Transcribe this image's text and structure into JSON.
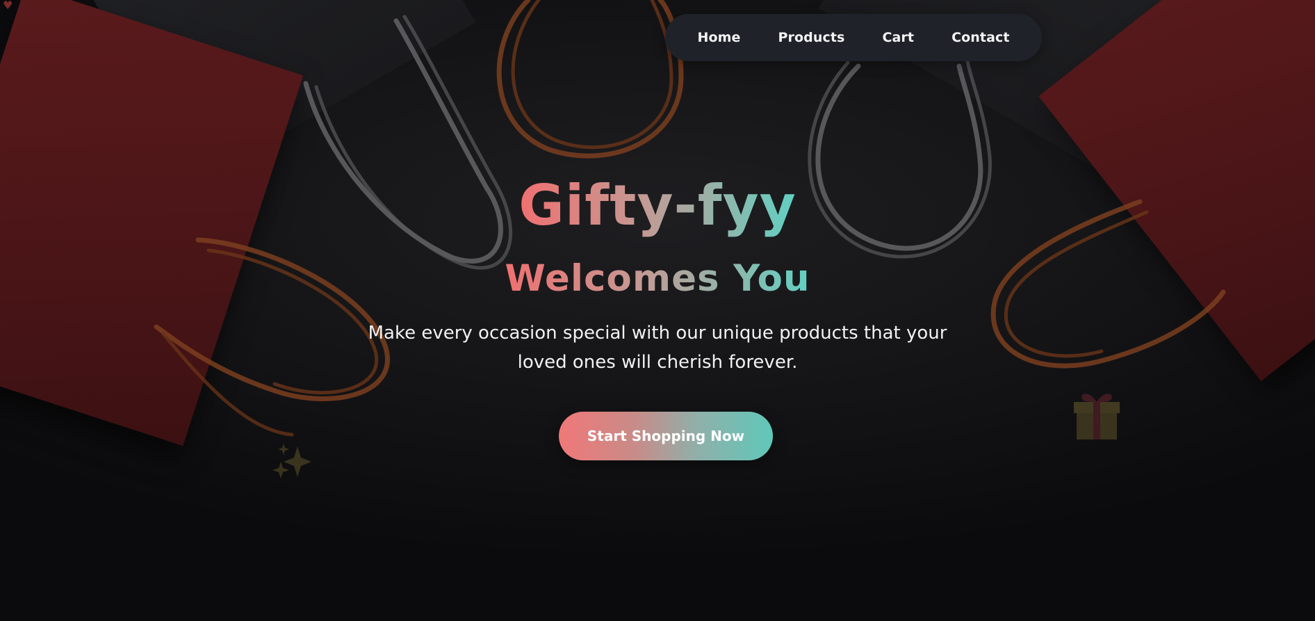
{
  "nav": {
    "items": [
      {
        "label": "Home"
      },
      {
        "label": "Products"
      },
      {
        "label": "Cart"
      },
      {
        "label": "Contact"
      }
    ]
  },
  "hero": {
    "title": "Gifty-fyy",
    "subtitle": "Welcomes You",
    "tagline": "Make every occasion special with our unique products that your loved ones will cherish forever.",
    "cta_label": "Start Shopping Now"
  },
  "colors": {
    "gradient_start": "#f07070",
    "gradient_end": "#5fd1c2",
    "nav_background": "#1f2329",
    "page_background": "#141416"
  },
  "icons": {
    "decorative_left": "sparkle-icon",
    "decorative_right": "gift-icon"
  }
}
